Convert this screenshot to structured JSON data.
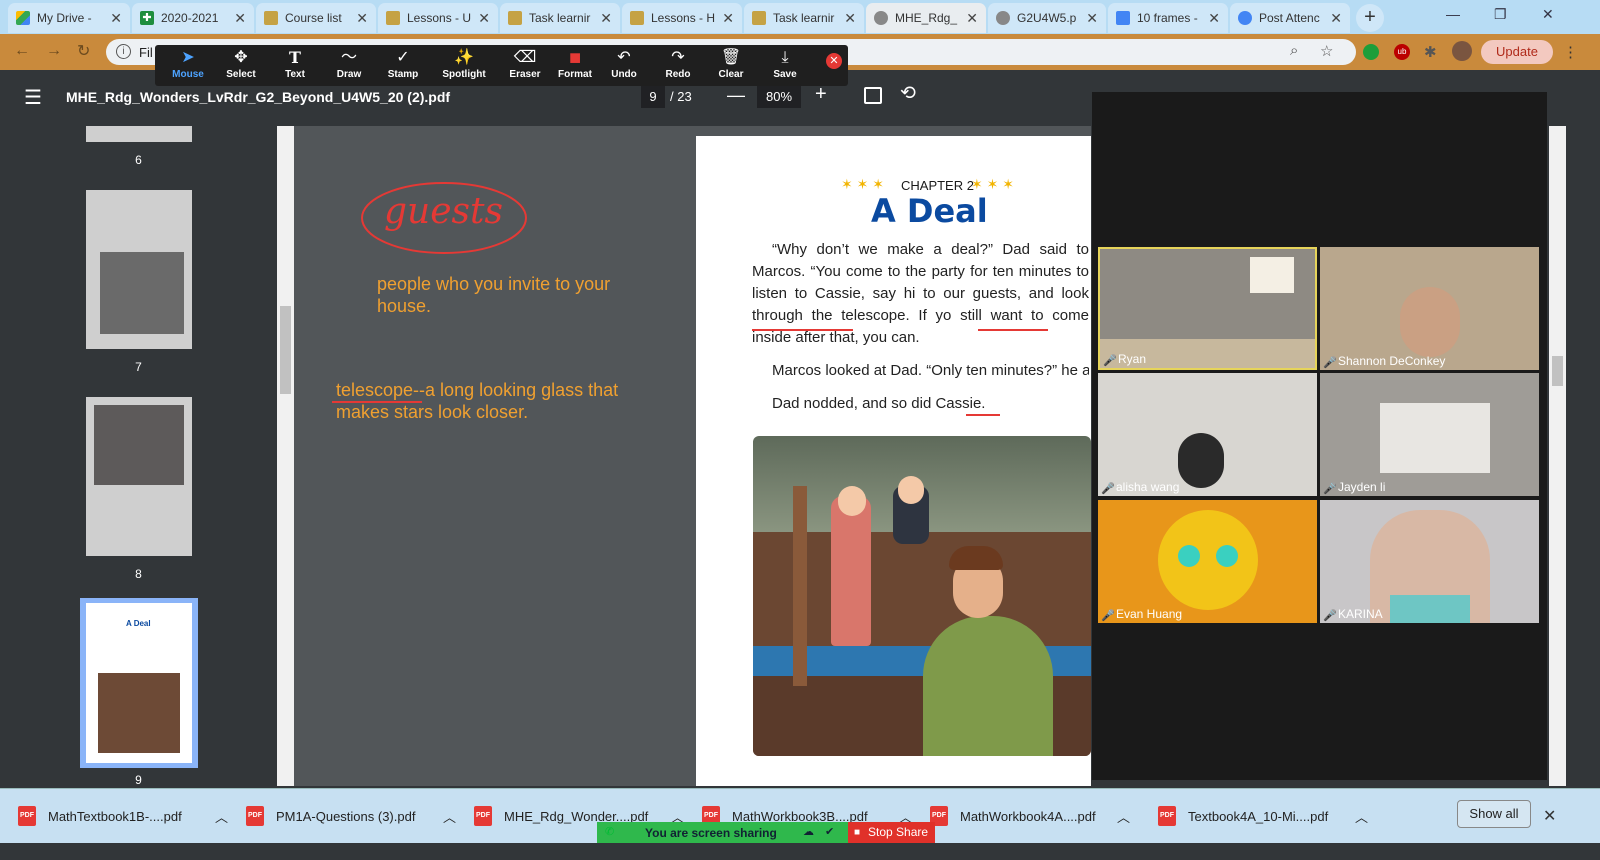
{
  "tabs": [
    {
      "title": "My Drive -",
      "icon_color": "#34a853",
      "active": false
    },
    {
      "title": "2020-2021",
      "icon_color": "#1e8e3e",
      "active": false
    },
    {
      "title": "Course list",
      "icon_color": "#c5a244",
      "active": false
    },
    {
      "title": "Lessons - U",
      "icon_color": "#c5a244",
      "active": false
    },
    {
      "title": "Task learnir",
      "icon_color": "#c5a244",
      "active": false
    },
    {
      "title": "Lessons - H",
      "icon_color": "#c5a244",
      "active": false
    },
    {
      "title": "Task learnir",
      "icon_color": "#c5a244",
      "active": false
    },
    {
      "title": "MHE_Rdg_",
      "icon_color": "#777777",
      "active": true
    },
    {
      "title": "G2U4W5.p",
      "icon_color": "#777777",
      "active": false
    },
    {
      "title": "10 frames -",
      "icon_color": "#4285f4",
      "active": false
    },
    {
      "title": "Post Attenc",
      "icon_color": "#4285f4",
      "active": false
    }
  ],
  "addr": {
    "text": "Fil",
    "update_label": "Update"
  },
  "toolbar": {
    "tools": [
      {
        "label": "Mouse",
        "icon": "cursor-icon",
        "glyph": "➤",
        "selected": true
      },
      {
        "label": "Select",
        "icon": "move-icon",
        "glyph": "✥",
        "selected": false
      },
      {
        "label": "Text",
        "icon": "text-icon",
        "glyph": "T",
        "selected": false
      },
      {
        "label": "Draw",
        "icon": "draw-icon",
        "glyph": "〜",
        "selected": false
      },
      {
        "label": "Stamp",
        "icon": "stamp-icon",
        "glyph": "✓",
        "selected": false
      },
      {
        "label": "Spotlight",
        "icon": "spotlight-icon",
        "glyph": "✨",
        "selected": false
      },
      {
        "label": "Eraser",
        "icon": "eraser-icon",
        "glyph": "⌫",
        "selected": false
      },
      {
        "label": "Format",
        "icon": "format-icon",
        "glyph": "■",
        "selected": false
      },
      {
        "label": "Undo",
        "icon": "undo-icon",
        "glyph": "↶",
        "selected": false
      },
      {
        "label": "Redo",
        "icon": "redo-icon",
        "glyph": "↷",
        "selected": false
      },
      {
        "label": "Clear",
        "icon": "trash-icon",
        "glyph": "🗑",
        "selected": false
      },
      {
        "label": "Save",
        "icon": "save-icon",
        "glyph": "⤓",
        "selected": false
      }
    ]
  },
  "pdf": {
    "title": "MHE_Rdg_Wonders_LvRdr_G2_Beyond_U4W5_20 (2).pdf",
    "page": "9",
    "total": "/ 23",
    "zoom": "80%"
  },
  "thumbnails": [
    "6",
    "7",
    "8",
    "9"
  ],
  "annotations": {
    "circled_word": "guests",
    "note1": "people who you invite to your house.",
    "note2": "telescope--a long looking glass that makes stars look closer."
  },
  "document": {
    "chapter": "CHAPTER 2",
    "title": "A Deal",
    "para1": "“Why don’t we make a deal?” Dad said to Marcos. “You come to the party for ten minutes to listen to Cassie, say hi to our guests, and look through the telescope. If yo still want to come inside after that, you can.",
    "para2": "Marcos looked at Dad. “Only ten minutes?” he ask",
    "para3": "Dad nodded, and so did Cassie."
  },
  "participants": [
    {
      "name": "Ryan",
      "bg": "#8e8a83",
      "highlight": true
    },
    {
      "name": "Shannon DeConkey",
      "bg": "#b9a78d",
      "highlight": false
    },
    {
      "name": "alisha wang",
      "bg": "#d8d6d1",
      "highlight": false
    },
    {
      "name": "Jayden li",
      "bg": "#9f9c97",
      "highlight": false
    },
    {
      "name": "Evan Huang",
      "bg": "#e8961a",
      "highlight": false
    },
    {
      "name": "KARINA",
      "bg": "#c8c6c8",
      "highlight": false
    }
  ],
  "downloads": [
    "MathTextbook1B-....pdf",
    "PM1A-Questions (3).pdf",
    "MHE_Rdg_Wonder....pdf",
    "MathWorkbook3B....pdf",
    "MathWorkbook4A....pdf",
    "Textbook4A_10-Mi....pdf"
  ],
  "download_bar": {
    "show_all": "Show all",
    "file_icon": "PDF"
  },
  "sharing": {
    "status": "You are screen sharing",
    "stop": "Stop Share"
  }
}
